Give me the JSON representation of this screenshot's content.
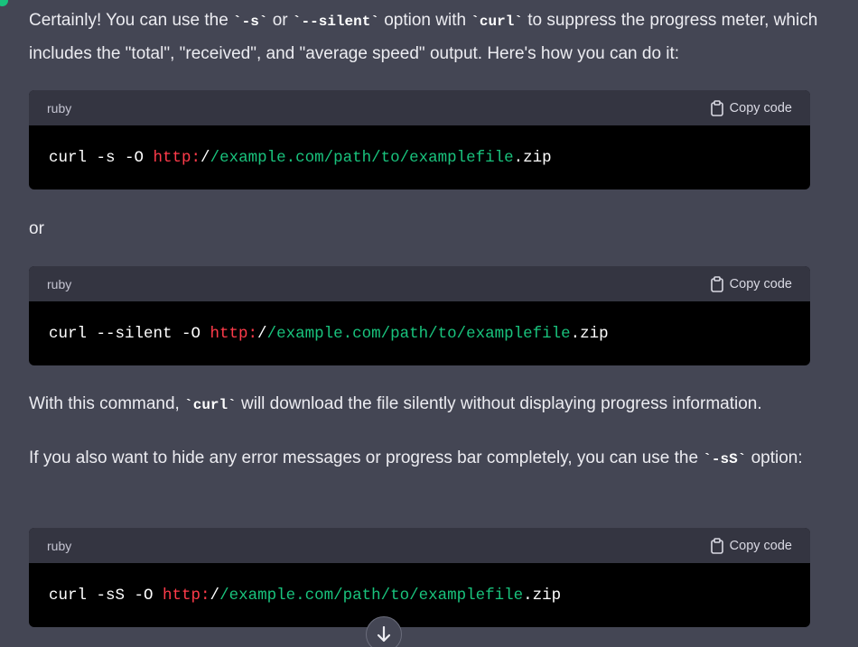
{
  "colors": {
    "background": "#444654",
    "code_header": "#343541",
    "code_body": "#000000",
    "url_protocol": "#ff3b4a",
    "url_path": "#19c37d",
    "avatar": "#19c37d"
  },
  "intro": {
    "t1": "Certainly! You can use the ",
    "c1": "`-s`",
    "t2": " or ",
    "c2": "`--silent`",
    "t3": " option with ",
    "c3": "`curl`",
    "t4": " to suppress the progress meter, which includes the \"total\", \"received\", and \"average speed\" output. Here's how you can do it:"
  },
  "or_text": "or",
  "middle": {
    "t1": "With this command, ",
    "c1": "`curl`",
    "t2": " will download the file silently without displaying progress information."
  },
  "advice": {
    "t1": "If you also want to hide any error messages or progress bar completely, you can use the ",
    "c1": "`-sS`",
    "t2": " option:"
  },
  "code_blocks": [
    {
      "language": "ruby",
      "copy_label": "Copy code",
      "prefix": "curl -s -O ",
      "protocol": "http:",
      "slash": "/",
      "path": "/example.com/path/to/examplefile",
      "suffix": ".zip"
    },
    {
      "language": "ruby",
      "copy_label": "Copy code",
      "prefix": "curl --silent -O ",
      "protocol": "http:",
      "slash": "/",
      "path": "/example.com/path/to/examplefile",
      "suffix": ".zip"
    },
    {
      "language": "ruby",
      "copy_label": "Copy code",
      "prefix": "curl -sS -O ",
      "protocol": "http:",
      "slash": "/",
      "path": "/example.com/path/to/examplefile",
      "suffix": ".zip"
    }
  ],
  "icons": {
    "copy": "clipboard-icon",
    "scroll": "arrow-down-icon",
    "avatar": "assistant-avatar-icon"
  }
}
